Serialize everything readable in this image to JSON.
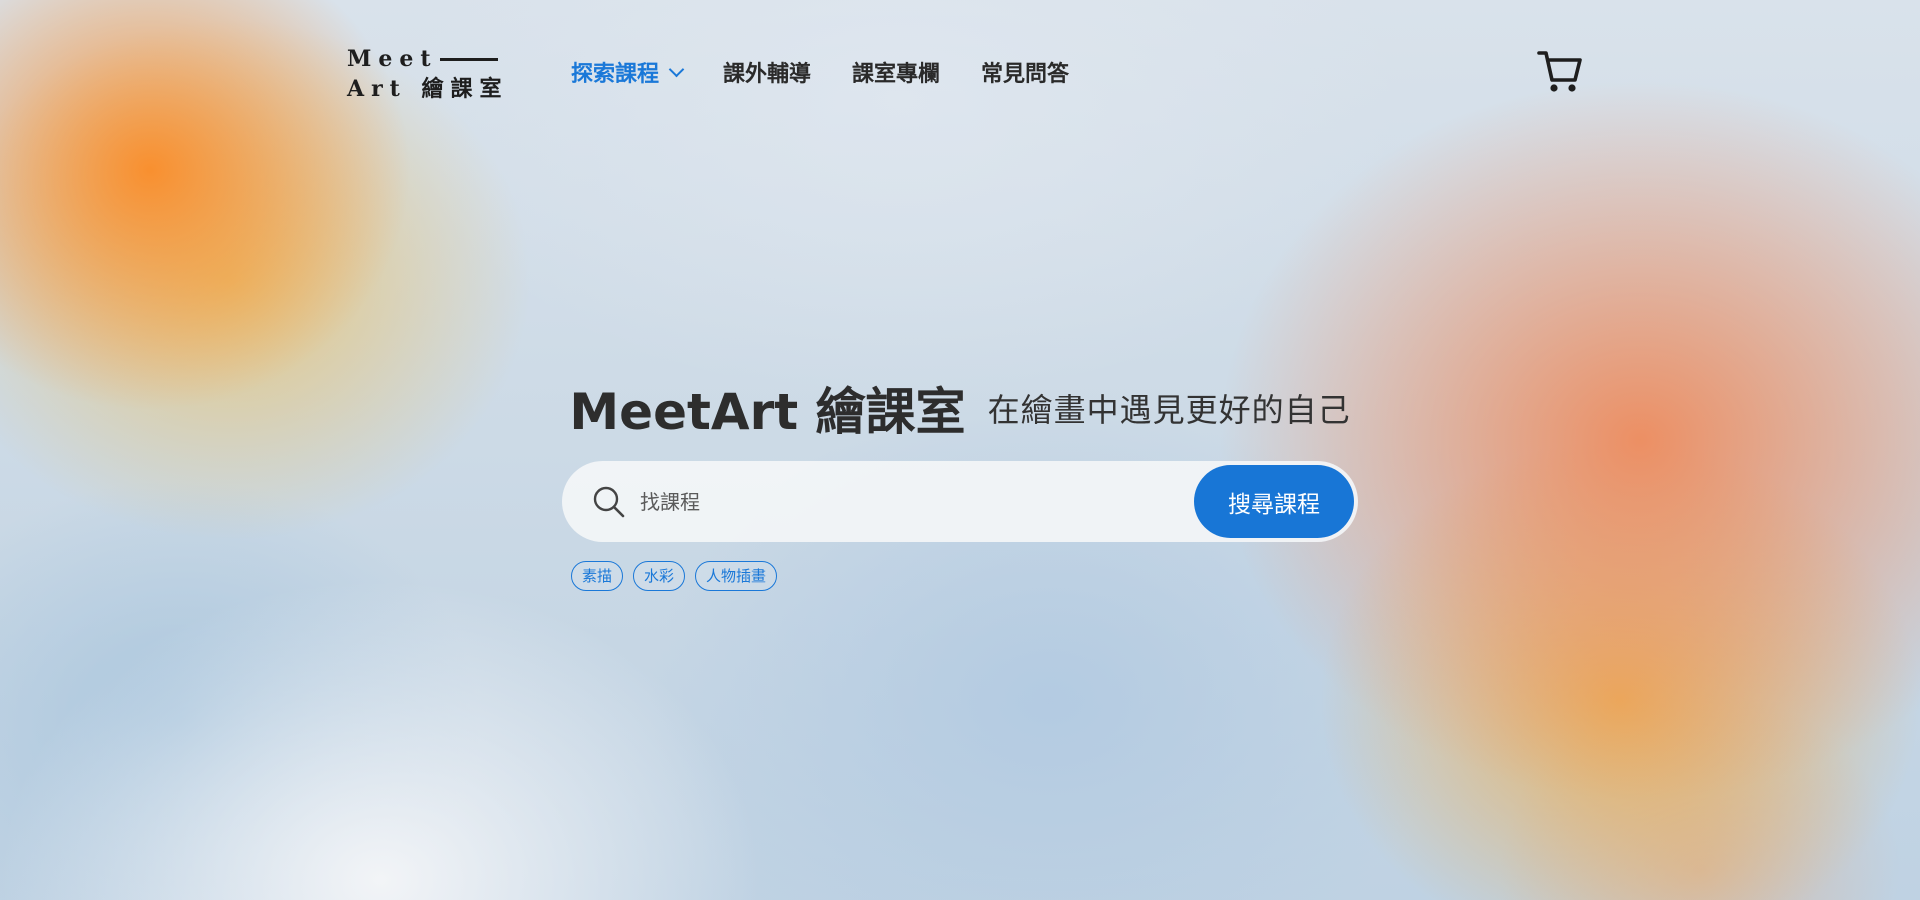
{
  "logo": {
    "line1": "Meet",
    "line2": "Art 繪課室"
  },
  "nav": {
    "items": [
      {
        "label": "探索課程",
        "active": true,
        "has_dropdown": true
      },
      {
        "label": "課外輔導"
      },
      {
        "label": "課室專欄"
      },
      {
        "label": "常見問答"
      }
    ],
    "active_color": "#1a78d8"
  },
  "cart": {
    "icon": "cart-icon"
  },
  "hero": {
    "title": "MeetArt 繪課室",
    "subtitle": "在繪畫中遇見更好的自己"
  },
  "search": {
    "icon": "search-icon",
    "placeholder": "找課程",
    "button_label": "搜尋課程",
    "button_color": "#1876d6"
  },
  "tags": [
    "素描",
    "水彩",
    "人物插畫"
  ]
}
